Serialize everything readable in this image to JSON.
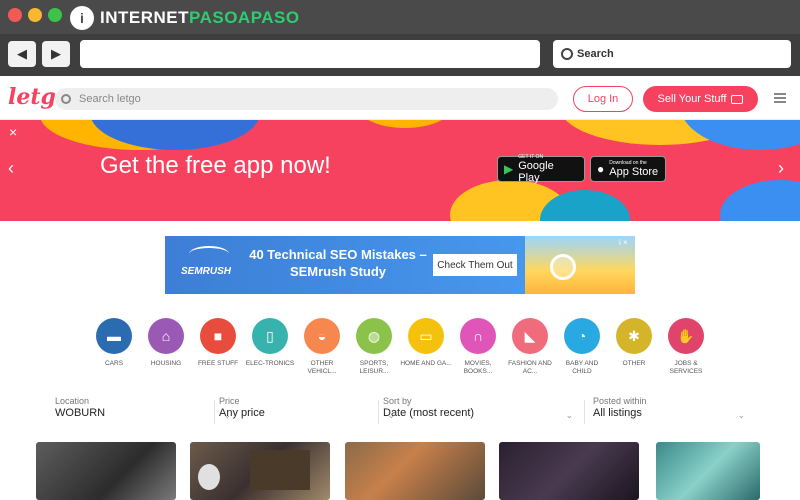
{
  "window": {
    "brand_part1": "INTERNET",
    "brand_part2": "PASOAPASO",
    "brand_mark": "i",
    "browser_search_placeholder": "Search"
  },
  "site": {
    "logo": "letgo",
    "search_placeholder": "Search letgo",
    "login_label": "Log In",
    "sell_label": "Sell Your Stuff"
  },
  "banner": {
    "headline": "Get the free app now!",
    "close": "×",
    "prev": "‹",
    "next": "›",
    "google_play_small": "GET IT ON",
    "google_play_big": "Google Play",
    "app_store_small": "Download on the",
    "app_store_big": "App Store"
  },
  "ad": {
    "brand": "SEMRUSH",
    "headline": "40 Technical SEO Mistakes – SEMrush Study",
    "cta": "Check Them Out",
    "info": "i ×"
  },
  "categories": [
    {
      "label": "CARS",
      "color": "#2b6cb0",
      "icon": "car-icon",
      "glyph": "🚗"
    },
    {
      "label": "HOUSING",
      "color": "#9b59b6",
      "icon": "house-icon",
      "glyph": "⌂"
    },
    {
      "label": "FREE STUFF",
      "color": "#e74c3c",
      "icon": "gift-icon",
      "glyph": "🎁"
    },
    {
      "label": "ELEC-TRONICS",
      "color": "#38b2ac",
      "icon": "phone-icon",
      "glyph": "▯"
    },
    {
      "label": "OTHER VEHICL...",
      "color": "#f5874f",
      "icon": "scooter-icon",
      "glyph": "🛵"
    },
    {
      "label": "SPORTS, LEISUR...",
      "color": "#8bc34a",
      "icon": "ball-icon",
      "glyph": "⚽"
    },
    {
      "label": "HOME AND GA...",
      "color": "#f4c20d",
      "icon": "sofa-icon",
      "glyph": "🛋"
    },
    {
      "label": "MOVIES, BOOKS...",
      "color": "#e056b8",
      "icon": "headphones-icon",
      "glyph": "🎧"
    },
    {
      "label": "FASHION AND AC...",
      "color": "#f06b7c",
      "icon": "heel-icon",
      "glyph": "👠"
    },
    {
      "label": "BABY AND CHILD",
      "color": "#29a9e1",
      "icon": "stroller-icon",
      "glyph": "👶"
    },
    {
      "label": "OTHER",
      "color": "#d4b52a",
      "icon": "other-icon",
      "glyph": "⚙"
    },
    {
      "label": "JOBS & SERVICES",
      "color": "#e0436b",
      "icon": "handshake-icon",
      "glyph": "🤝"
    }
  ],
  "filters": {
    "location_label": "Location",
    "location_value": "WOBURN",
    "price_label": "Price",
    "price_value": "Any price",
    "sort_label": "Sort by",
    "sort_value": "Date (most recent)",
    "posted_label": "Posted within",
    "posted_value": "All listings"
  },
  "colors": {
    "accent": "#f6425f",
    "chrome": "#4a4a4a"
  }
}
